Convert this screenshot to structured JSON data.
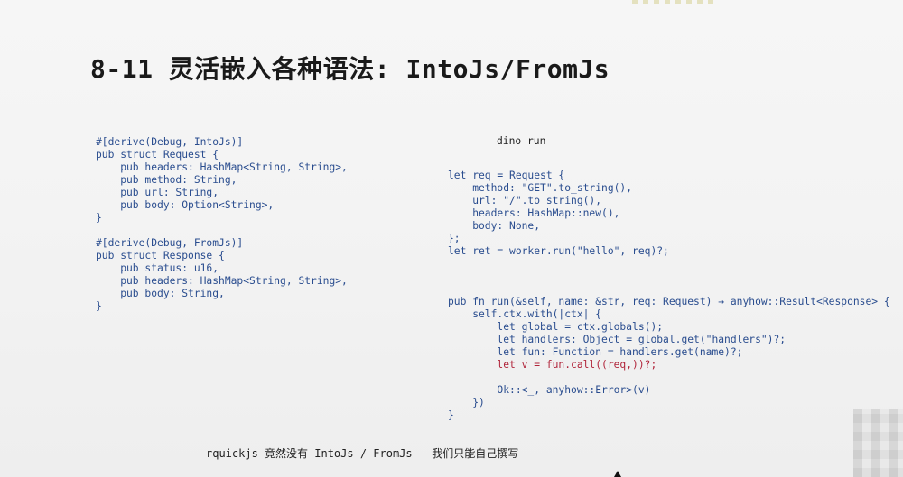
{
  "slide": {
    "title": "8-11 灵活嵌入各种语法: IntoJs/FromJs",
    "command": "dino run",
    "note": "rquickjs 竟然没有 IntoJs / FromJs - 我们只能自己撰写"
  },
  "code_left": {
    "lines": [
      "#[derive(Debug, IntoJs)]",
      "pub struct Request {",
      "    pub headers: HashMap<String, String>,",
      "    pub method: String,",
      "    pub url: String,",
      "    pub body: Option<String>,",
      "}",
      "",
      "#[derive(Debug, FromJs)]",
      "pub struct Response {",
      "    pub status: u16,",
      "    pub headers: HashMap<String, String>,",
      "    pub body: String,",
      "}"
    ]
  },
  "code_right": {
    "lines": [
      "let req = Request {",
      "    method: \"GET\".to_string(),",
      "    url: \"/\".to_string(),",
      "    headers: HashMap::new(),",
      "    body: None,",
      "};",
      "let ret = worker.run(\"hello\", req)?;",
      "",
      "",
      "",
      "pub fn run(&self, name: &str, req: Request) → anyhow::Result<Response> {",
      "    self.ctx.with(|ctx| {",
      "        let global = ctx.globals();",
      "        let handlers: Object = global.get(\"handlers\")?;",
      "        let fun: Function = handlers.get(name)?;",
      "        let v = fun.call((req,))?;",
      "",
      "        Ok::<_, anyhow::Error>(v)",
      "    })",
      "}"
    ],
    "highlight_line_index": 15
  },
  "colors": {
    "code": "#2a4d8f",
    "highlight": "#b0243a",
    "title": "#1a1a1a"
  }
}
